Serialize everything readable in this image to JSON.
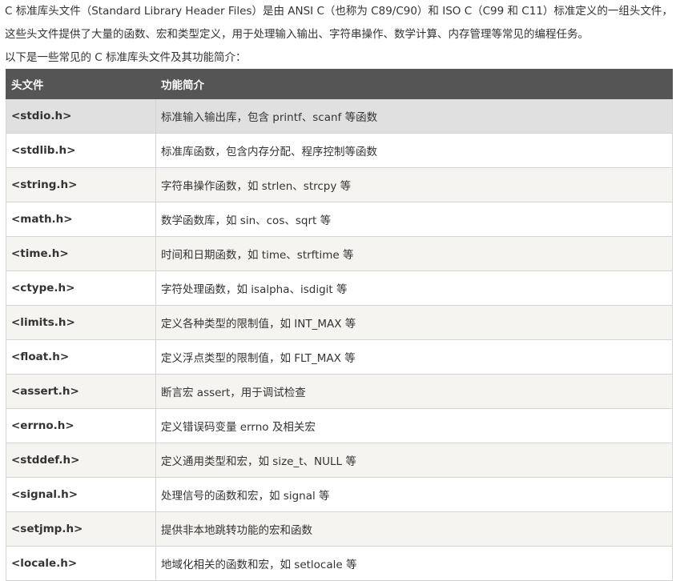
{
  "intro": {
    "line1": "C 标准库头文件（Standard Library Header Files）是由 ANSI C（也称为 C89/C90）和 ISO C（C99 和 C11）标准定义的一组头文件，",
    "line2": "这些头文件提供了大量的函数、宏和类型定义，用于处理输入输出、字符串操作、数学计算、内存管理等常见的编程任务。",
    "line3": "以下是一些常见的 C 标准库头文件及其功能简介："
  },
  "table": {
    "headers": [
      "头文件",
      "功能简介"
    ],
    "rows": [
      {
        "name": "<stdio.h>",
        "desc": "标准输入输出库，包含 printf、scanf 等函数"
      },
      {
        "name": "<stdlib.h>",
        "desc": "标准库函数，包含内存分配、程序控制等函数"
      },
      {
        "name": "<string.h>",
        "desc": "字符串操作函数，如 strlen、strcpy 等"
      },
      {
        "name": "<math.h>",
        "desc": "数学函数库，如 sin、cos、sqrt 等"
      },
      {
        "name": "<time.h>",
        "desc": "时间和日期函数，如 time、strftime 等"
      },
      {
        "name": "<ctype.h>",
        "desc": "字符处理函数，如 isalpha、isdigit 等"
      },
      {
        "name": "<limits.h>",
        "desc": "定义各种类型的限制值，如 INT_MAX 等"
      },
      {
        "name": "<float.h>",
        "desc": "定义浮点类型的限制值，如 FLT_MAX 等"
      },
      {
        "name": "<assert.h>",
        "desc": "断言宏 assert，用于调试检查"
      },
      {
        "name": "<errno.h>",
        "desc": "定义错误码变量 errno 及相关宏"
      },
      {
        "name": "<stddef.h>",
        "desc": "定义通用类型和宏，如 size_t、NULL 等"
      },
      {
        "name": "<signal.h>",
        "desc": "处理信号的函数和宏，如 signal 等"
      },
      {
        "name": "<setjmp.h>",
        "desc": "提供非本地跳转功能的宏和函数"
      },
      {
        "name": "<locale.h>",
        "desc": "地域化相关的函数和宏，如 setlocale 等"
      }
    ]
  },
  "colors": {
    "header_bg": "#555555",
    "header_text": "#ffffff",
    "row_alt_bg": "#f6f4f0",
    "row_highlight_bg": "#e0e0e0",
    "border": "#d4d4d4",
    "text": "#333333"
  }
}
